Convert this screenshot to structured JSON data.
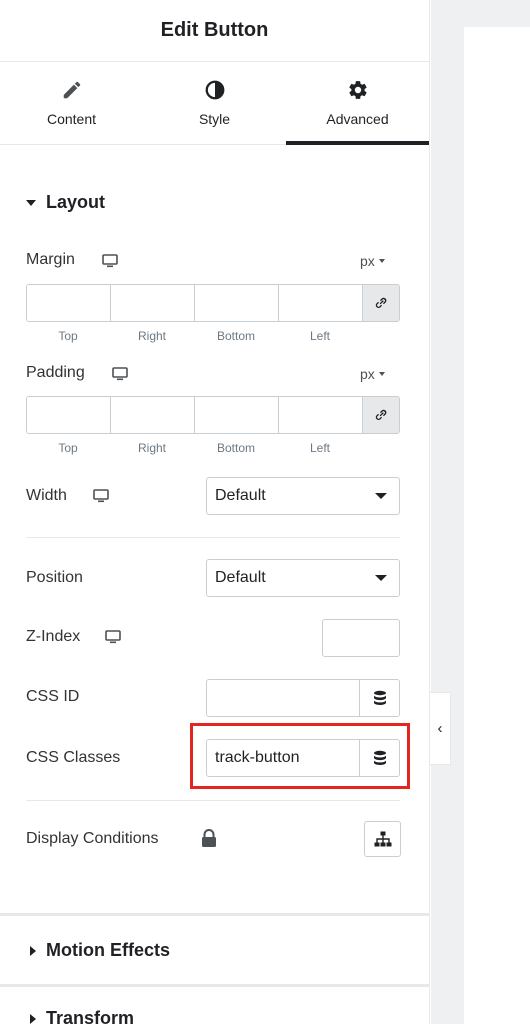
{
  "header": {
    "title": "Edit Button"
  },
  "tabs": [
    {
      "label": "Content",
      "icon": "pencil-icon"
    },
    {
      "label": "Style",
      "icon": "contrast-icon"
    },
    {
      "label": "Advanced",
      "icon": "gear-icon",
      "active": true
    }
  ],
  "layout": {
    "title": "Layout",
    "margin": {
      "label": "Margin",
      "unit": "px",
      "sides": [
        "Top",
        "Right",
        "Bottom",
        "Left"
      ]
    },
    "padding": {
      "label": "Padding",
      "unit": "px",
      "sides": [
        "Top",
        "Right",
        "Bottom",
        "Left"
      ]
    },
    "width": {
      "label": "Width",
      "value": "Default"
    },
    "position": {
      "label": "Position",
      "value": "Default"
    },
    "z_index": {
      "label": "Z-Index",
      "value": ""
    },
    "css_id": {
      "label": "CSS ID",
      "value": ""
    },
    "css_classes": {
      "label": "CSS Classes",
      "value": "track-button"
    },
    "display_conditions": {
      "label": "Display Conditions"
    }
  },
  "sections": {
    "motion_effects": "Motion Effects",
    "transform": "Transform"
  },
  "colors": {
    "highlight": "#e3261f",
    "text": "#1f2124"
  }
}
